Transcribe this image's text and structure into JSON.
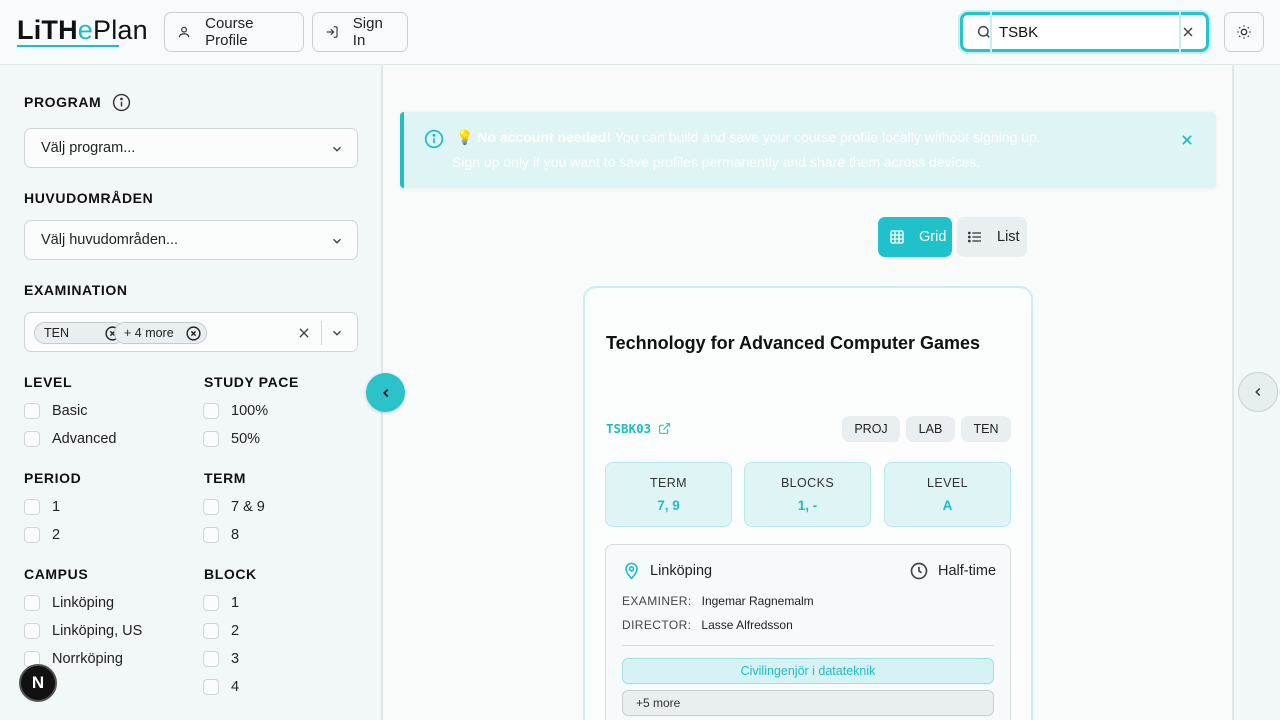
{
  "header": {
    "logo": {
      "part1": "LiTH",
      "part2": "e",
      "part3": "Plan"
    },
    "course_profile_label": "Course Profile",
    "sign_in_label": "Sign In",
    "search": {
      "value": "TSBK",
      "placeholder": ""
    }
  },
  "sidebar": {
    "program": {
      "label": "PROGRAM",
      "placeholder": "Välj program..."
    },
    "main_areas": {
      "label": "HUVUDOMRÅDEN",
      "placeholder": "Välj huvudområden..."
    },
    "examination": {
      "label": "EXAMINATION",
      "chips": [
        "TEN",
        "+ 4 more"
      ]
    },
    "level": {
      "label": "LEVEL",
      "options": [
        "Basic",
        "Advanced"
      ]
    },
    "study_pace": {
      "label": "STUDY PACE",
      "options": [
        "100%",
        "50%"
      ]
    },
    "period": {
      "label": "PERIOD",
      "options": [
        "1",
        "2"
      ]
    },
    "term": {
      "label": "TERM",
      "options": [
        "7 & 9",
        "8"
      ]
    },
    "campus": {
      "label": "CAMPUS",
      "options": [
        "Linköping",
        "Linköping, US",
        "Norrköping"
      ]
    },
    "block": {
      "label": "BLOCK",
      "options": [
        "1",
        "2",
        "3",
        "4"
      ]
    }
  },
  "dev_badge": "N",
  "banner": {
    "emoji": "💡",
    "bold": "No account needed!",
    "text": " You can build and save your course profile locally without signing up.",
    "line2": "Sign up only if you want to save profiles permanently and share them across devices."
  },
  "view_toggle": {
    "grid": "Grid",
    "list": "List"
  },
  "course": {
    "title": "Technology for Advanced Computer Games",
    "code": "TSBK03",
    "tags": [
      "PROJ",
      "LAB",
      "TEN"
    ],
    "stats": [
      {
        "label": "TERM",
        "value": "7, 9"
      },
      {
        "label": "BLOCKS",
        "value": "1, -"
      },
      {
        "label": "LEVEL",
        "value": "A"
      }
    ],
    "campus": "Linköping",
    "pace": "Half-time",
    "examiner_label": "EXAMINER:",
    "examiner": "Ingemar Ragnemalm",
    "director_label": "DIRECTOR:",
    "director": "Lasse Alfredsson",
    "program": "Civilingenjör i datateknik",
    "more_programs": "+5 more"
  },
  "colors": {
    "accent": "#1fbcc6",
    "banner_bg": "#dff4f5"
  }
}
